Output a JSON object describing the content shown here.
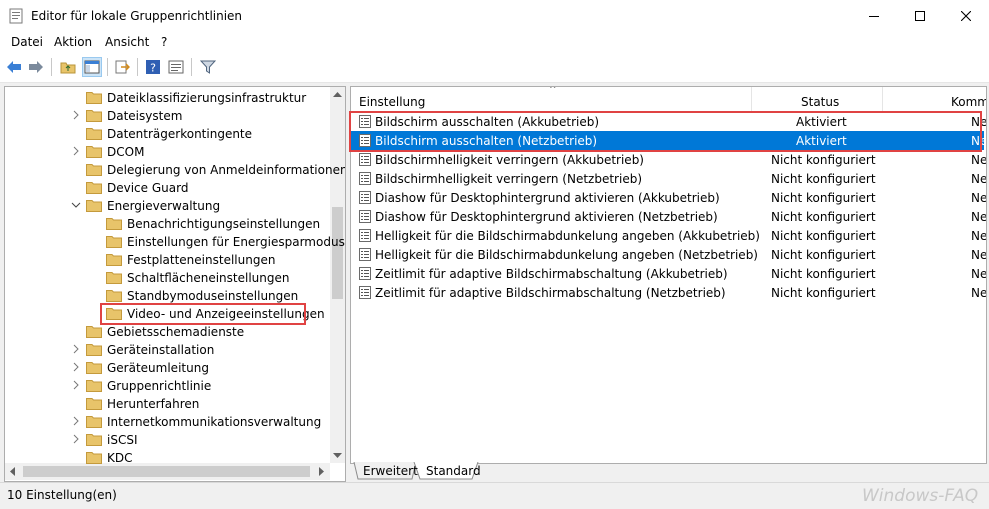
{
  "window": {
    "title": "Editor für lokale Gruppenrichtlinien"
  },
  "menu": [
    "Datei",
    "Aktion",
    "Ansicht",
    "?"
  ],
  "tree": {
    "items": [
      {
        "label": "Dateiklassifizierungsinfrastruktur",
        "level": 1,
        "expander": "none"
      },
      {
        "label": "Dateisystem",
        "level": 1,
        "expander": "collapsed"
      },
      {
        "label": "Datenträgerkontingente",
        "level": 1,
        "expander": "none"
      },
      {
        "label": "DCOM",
        "level": 1,
        "expander": "collapsed"
      },
      {
        "label": "Delegierung von Anmeldeinformationen",
        "level": 1,
        "expander": "none"
      },
      {
        "label": "Device Guard",
        "level": 1,
        "expander": "none"
      },
      {
        "label": "Energieverwaltung",
        "level": 1,
        "expander": "expanded"
      },
      {
        "label": "Benachrichtigungseinstellungen",
        "level": 2,
        "expander": "none"
      },
      {
        "label": "Einstellungen für Energiesparmodus",
        "level": 2,
        "expander": "none"
      },
      {
        "label": "Festplatteneinstellungen",
        "level": 2,
        "expander": "none"
      },
      {
        "label": "Schaltflächeneinstellungen",
        "level": 2,
        "expander": "none"
      },
      {
        "label": "Standbymoduseinstellungen",
        "level": 2,
        "expander": "none"
      },
      {
        "label": "Video- und Anzeigeeinstellungen",
        "level": 2,
        "expander": "none",
        "selected": true
      },
      {
        "label": "Gebietsschemadienste",
        "level": 1,
        "expander": "none"
      },
      {
        "label": "Geräteinstallation",
        "level": 1,
        "expander": "collapsed"
      },
      {
        "label": "Geräteumleitung",
        "level": 1,
        "expander": "collapsed"
      },
      {
        "label": "Gruppenrichtlinie",
        "level": 1,
        "expander": "collapsed"
      },
      {
        "label": "Herunterfahren",
        "level": 1,
        "expander": "none"
      },
      {
        "label": "Internetkommunikationsverwaltung",
        "level": 1,
        "expander": "collapsed"
      },
      {
        "label": "iSCSI",
        "level": 1,
        "expander": "collapsed"
      },
      {
        "label": "KDC",
        "level": 1,
        "expander": "none"
      }
    ]
  },
  "list": {
    "columns": {
      "setting": "Einstellung",
      "status": "Status",
      "comment": "Komm"
    },
    "rows": [
      {
        "name": "Bildschirm ausschalten (Akkubetrieb)",
        "status": "Aktiviert",
        "comment": "Ne"
      },
      {
        "name": "Bildschirm ausschalten (Netzbetrieb)",
        "status": "Aktiviert",
        "comment": "Ne",
        "selected": true
      },
      {
        "name": "Bildschirmhelligkeit verringern (Akkubetrieb)",
        "status": "Nicht konfiguriert",
        "comment": "Ne"
      },
      {
        "name": "Bildschirmhelligkeit verringern (Netzbetrieb)",
        "status": "Nicht konfiguriert",
        "comment": "Ne"
      },
      {
        "name": "Diashow für Desktophintergrund aktivieren (Akkubetrieb)",
        "status": "Nicht konfiguriert",
        "comment": "Ne"
      },
      {
        "name": "Diashow für Desktophintergrund aktivieren (Netzbetrieb)",
        "status": "Nicht konfiguriert",
        "comment": "Ne"
      },
      {
        "name": "Helligkeit für die Bildschirmabdunkelung angeben (Akkubetrieb)",
        "status": "Nicht konfiguriert",
        "comment": "Ne"
      },
      {
        "name": "Helligkeit für die Bildschirmabdunkelung angeben (Netzbetrieb)",
        "status": "Nicht konfiguriert",
        "comment": "Ne"
      },
      {
        "name": "Zeitlimit für adaptive Bildschirmabschaltung (Akkubetrieb)",
        "status": "Nicht konfiguriert",
        "comment": "Ne"
      },
      {
        "name": "Zeitlimit für adaptive Bildschirmabschaltung (Netzbetrieb)",
        "status": "Nicht konfiguriert",
        "comment": "Ne"
      }
    ]
  },
  "tabs": [
    "Erweitert",
    "Standard"
  ],
  "status_bar": {
    "text": "10 Einstellung(en)"
  },
  "watermark": "Windows-FAQ",
  "colors": {
    "selection": "#0078d7",
    "highlight_box": "#e04343",
    "folder": "#e8c46a"
  }
}
